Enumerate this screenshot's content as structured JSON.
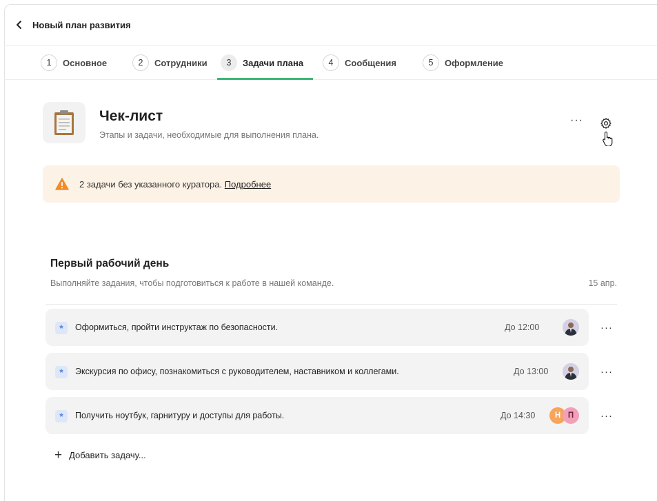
{
  "header": {
    "title": "Новый план развития"
  },
  "tabs": [
    {
      "num": "1",
      "label": "Основное",
      "active": false
    },
    {
      "num": "2",
      "label": "Сотрудники",
      "active": false
    },
    {
      "num": "3",
      "label": "Задачи плана",
      "active": true
    },
    {
      "num": "4",
      "label": "Сообщения",
      "active": false
    },
    {
      "num": "5",
      "label": "Оформление",
      "active": false
    }
  ],
  "page": {
    "title": "Чек-лист",
    "subtitle": "Этапы и задачи, необходимые для выполнения плана.",
    "more": "···"
  },
  "warning": {
    "text": "2 задачи без указанного куратора. ",
    "link": "Подробнее"
  },
  "section": {
    "title": "Первый рабочий день",
    "description": "Выполняйте задания, чтобы подготовиться к работе в нашей команде.",
    "date": "15 апр."
  },
  "tasks": [
    {
      "icon": "*",
      "title": "Оформиться, пройти инструктаж по безопасности.",
      "due": "До 12:00",
      "assignees": [
        "photo"
      ],
      "more": "···"
    },
    {
      "icon": "*",
      "title": "Экскурсия по офису, познакомиться с руководителем, наставником и коллегами.",
      "due": "До 13:00",
      "assignees": [
        "photo"
      ],
      "more": "···"
    },
    {
      "icon": "*",
      "title": "Получить ноутбук, гарнитуру и доступы для работы.",
      "due": "До 14:30",
      "assignees": [
        "Н",
        "П"
      ],
      "more": "···"
    }
  ],
  "add_task": {
    "plus": "+",
    "label": "Добавить задачу..."
  },
  "colors": {
    "accent_green": "#3fb776",
    "warning_bg": "#fdf2e6",
    "warning_icon": "#f08c2a",
    "task_bg": "#f3f3f3",
    "task_icon": "#5a86d9",
    "avatar_n": "#f6a55c",
    "avatar_p": "#f2a0b8"
  }
}
